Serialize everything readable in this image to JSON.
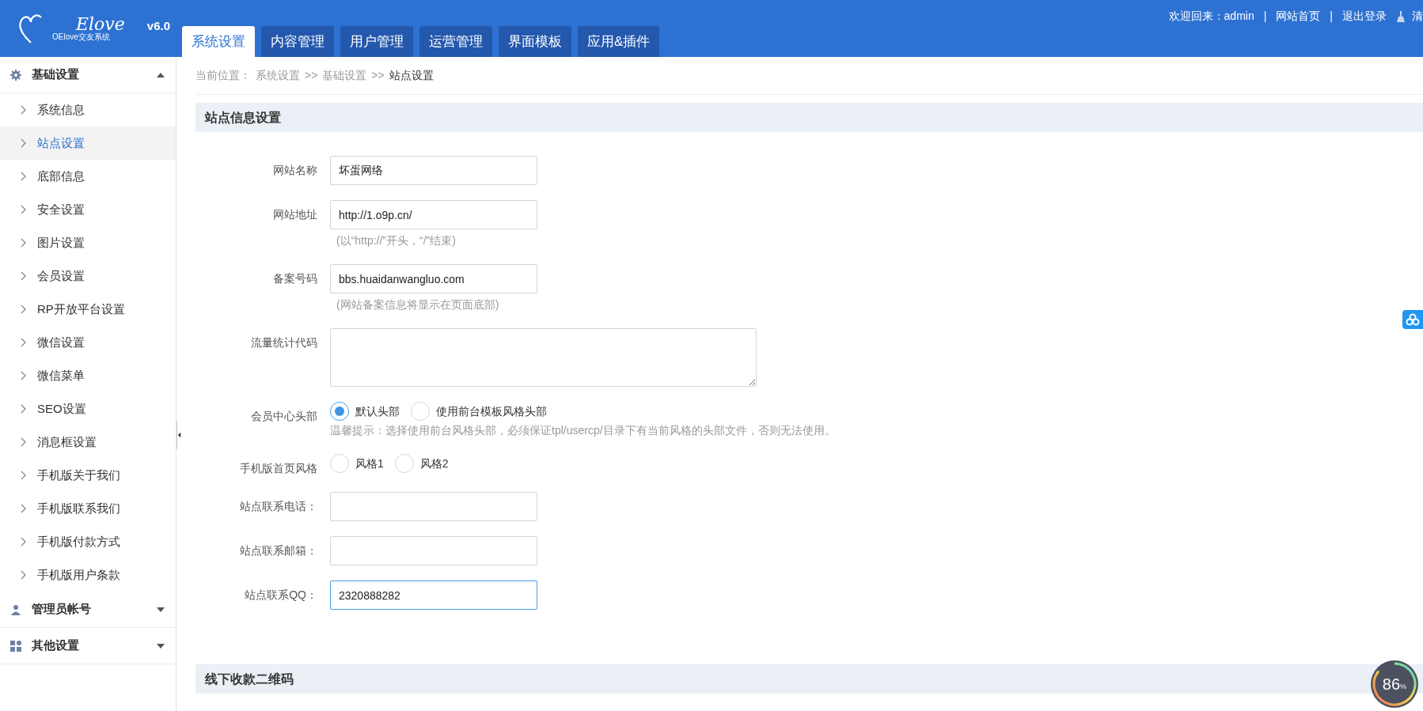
{
  "logo": {
    "script": "Elove",
    "name": "OElove交友系统",
    "version": "v6.0"
  },
  "tabs": [
    {
      "label": "系统设置",
      "selected": true
    },
    {
      "label": "内容管理",
      "selected": false
    },
    {
      "label": "用户管理",
      "selected": false
    },
    {
      "label": "运营管理",
      "selected": false
    },
    {
      "label": "界面模板",
      "selected": false
    },
    {
      "label": "应用&插件",
      "selected": false
    }
  ],
  "top_links": {
    "welcome": "欢迎回来：admin",
    "links": [
      "网站首页",
      "退出登录"
    ],
    "separator": "|",
    "clear": "清"
  },
  "sidebar": [
    {
      "label": "基础设置",
      "expanded": true,
      "children": [
        {
          "label": "系统信息",
          "selected": false
        },
        {
          "label": "站点设置",
          "selected": true
        },
        {
          "label": "底部信息",
          "selected": false
        },
        {
          "label": "安全设置",
          "selected": false
        },
        {
          "label": "图片设置",
          "selected": false
        },
        {
          "label": "会员设置",
          "selected": false
        },
        {
          "label": "RP开放平台设置",
          "selected": false
        },
        {
          "label": "微信设置",
          "selected": false
        },
        {
          "label": "微信菜单",
          "selected": false
        },
        {
          "label": "SEO设置",
          "selected": false
        },
        {
          "label": "消息框设置",
          "selected": false
        },
        {
          "label": "手机版关于我们",
          "selected": false
        },
        {
          "label": "手机版联系我们",
          "selected": false
        },
        {
          "label": "手机版付款方式",
          "selected": false
        },
        {
          "label": "手机版用户条款",
          "selected": false
        }
      ]
    },
    {
      "label": "管理员帐号",
      "expanded": false
    },
    {
      "label": "其他设置",
      "expanded": false
    }
  ],
  "breadcrumb": [
    "当前位置：",
    "系统设置",
    ">>",
    "基础设置",
    ">>",
    "站点设置"
  ],
  "sections": [
    {
      "title": "站点信息设置",
      "fields": [
        {
          "kind": "text",
          "label": "网站名称",
          "value": "坏蛋网络"
        },
        {
          "kind": "text",
          "label": "网站地址",
          "value": "http://1.o9p.cn/",
          "hint": "(以“http://”开头，“/”结束)"
        },
        {
          "kind": "text",
          "label": "备案号码",
          "value": "bbs.huaidanwangluo.com",
          "hint": "(网站备案信息将显示在页面底部)"
        },
        {
          "kind": "textarea",
          "label": "流量统计代码"
        },
        {
          "kind": "radio",
          "label": "会员中心头部",
          "options": [
            {
              "label": "默认头部",
              "selected": true
            },
            {
              "label": "使用前台模板风格头部",
              "selected": false
            }
          ],
          "hint": "温馨提示：选择使用前台风格头部，必须保证tpl/usercp/目录下有当前风格的头部文件，否则无法使用。"
        },
        {
          "kind": "radio",
          "label": "手机版首页风格",
          "options": [
            {
              "label": "风格1",
              "selected": false
            },
            {
              "label": "风格2",
              "selected": false
            }
          ]
        },
        {
          "kind": "text",
          "label": "站点联系电话："
        },
        {
          "kind": "text",
          "label": "站点联系邮箱："
        },
        {
          "kind": "text",
          "label": "站点联系QQ：",
          "value": "2320888282",
          "focused": true
        }
      ]
    },
    {
      "title": "线下收款二维码"
    }
  ],
  "gauge": {
    "reading": "86",
    "unit": "%",
    "level": 0.86
  }
}
